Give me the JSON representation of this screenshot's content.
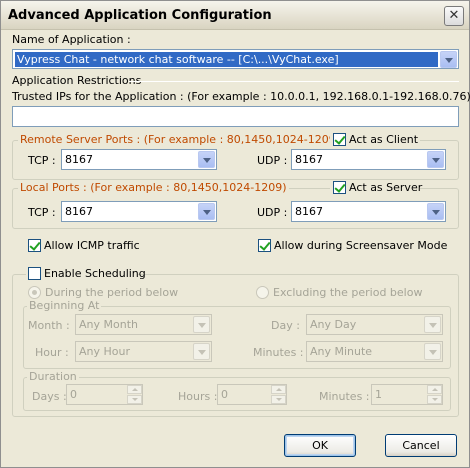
{
  "window": {
    "title": "Advanced Application Configuration",
    "close_glyph": "✕"
  },
  "app": {
    "name_label": "Name of Application :",
    "selected": "Vypress Chat - network chat software -- [C:\\...\\VyChat.exe]"
  },
  "restrictions": {
    "heading": "Application Restrictions",
    "trusted_label": "Trusted IPs for the Application :  (For example : 10.0.0.1, 192.168.0.1-192.168.0.76)",
    "trusted_value": ""
  },
  "remote": {
    "title": "Remote Server Ports :  (For example : 80,1450,1024-1209)",
    "act_label": "Act as Client",
    "act_checked": true,
    "tcp_label": "TCP :",
    "tcp_value": "8167",
    "udp_label": "UDP :",
    "udp_value": "8167"
  },
  "local": {
    "title": "Local Ports : (For example : 80,1450,1024-1209)",
    "act_label": "Act as Server",
    "act_checked": true,
    "tcp_label": "TCP :",
    "tcp_value": "8167",
    "udp_label": "UDP :",
    "udp_value": "8167"
  },
  "options": {
    "icmp_label": "Allow ICMP traffic",
    "icmp_checked": true,
    "screensaver_label": "Allow during Screensaver Mode",
    "screensaver_checked": true
  },
  "scheduling": {
    "enable_label": "Enable Scheduling",
    "enable_checked": false,
    "during_label": "During the period below",
    "excluding_label": "Excluding the period below",
    "beginning": {
      "title": "Beginning At",
      "month_label": "Month :",
      "month_value": "Any Month",
      "day_label": "Day :",
      "day_value": "Any Day",
      "hour_label": "Hour :",
      "hour_value": "Any Hour",
      "minutes_label": "Minutes :",
      "minutes_value": "Any Minute"
    },
    "duration": {
      "title": "Duration",
      "days_label": "Days :",
      "days_value": "0",
      "hours_label": "Hours :",
      "hours_value": "0",
      "minutes_label": "Minutes :",
      "minutes_value": "1"
    }
  },
  "buttons": {
    "ok": "OK",
    "cancel": "Cancel"
  },
  "colors": {
    "face": "#ece9d8",
    "group_label": "#c04a00",
    "selection": "#316ac5"
  }
}
